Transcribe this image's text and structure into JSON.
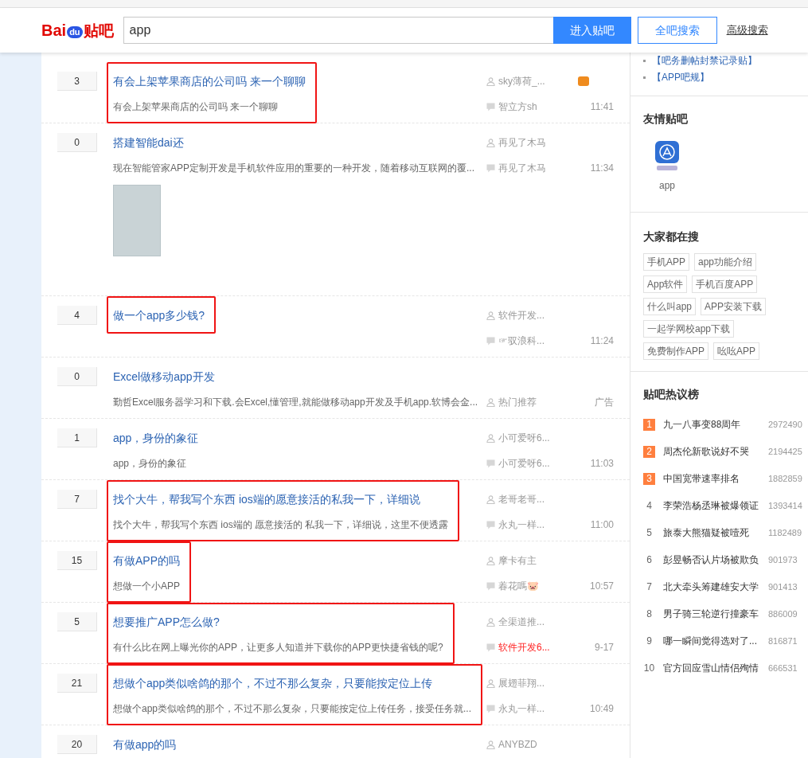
{
  "header": {
    "logo": {
      "text_a": "Bai",
      "text_b": "du",
      "text_c": "贴吧"
    },
    "search": {
      "value": "app"
    },
    "buttons": [
      {
        "label": "进入贴吧",
        "kind": "primary"
      },
      {
        "label": "全吧搜索",
        "kind": "outline"
      }
    ],
    "advanced_link": "高级搜索"
  },
  "threads": [
    {
      "kind": "thread",
      "replies": "3",
      "title": "有会上架苹果商店的公司吗 来一个聊聊",
      "abstract": "有会上架苹果商店的公司吗 来一个聊聊",
      "author": "sky薄荷_...",
      "author_badge": true,
      "replier": "智立方sh",
      "replier_vip": false,
      "time": "11:41",
      "highlighted": true
    },
    {
      "kind": "thread",
      "replies": "0",
      "title": "搭建智能dai还",
      "abstract": "现在智能管家APP定制开发是手机软件应用的重要的一种开发，随着移动互联网的覆...",
      "image": true,
      "author": "再见了木马",
      "replier": "再见了木马",
      "replier_vip": false,
      "time": "11:34",
      "highlighted": false
    },
    {
      "kind": "thread",
      "replies": "4",
      "title": "做一个app多少钱?",
      "author": "软件开发...",
      "replier": "☞驭浪科...",
      "replier_vip": false,
      "time": "11:24",
      "highlighted": true
    },
    {
      "kind": "ad",
      "replies": "0",
      "title": "Excel做移动app开发",
      "abstract": "勤哲Excel服务器学习和下载.会Excel,懂管理,就能做移动app开发及手机app.软博会金...",
      "author": "热门推荐",
      "time": "广告",
      "highlighted": false
    },
    {
      "kind": "thread",
      "replies": "1",
      "title": "app，身份的象征",
      "abstract": "app，身份的象征",
      "author": "小可爱呀6...",
      "replier": "小可爱呀6...",
      "replier_vip": false,
      "time": "11:03",
      "highlighted": false
    },
    {
      "kind": "thread",
      "replies": "7",
      "title": "找个大牛，帮我写个东西 ios端的愿意接活的私我一下，详细说",
      "abstract": "找个大牛，帮我写个东西 ios端的 愿意接活的 私我一下，详细说，这里不便透露",
      "author": "老哥老哥...",
      "replier": "永丸一样...",
      "replier_vip": false,
      "time": "11:00",
      "highlighted": true
    },
    {
      "kind": "thread",
      "replies": "15",
      "title": "有做APP的吗",
      "abstract": "想做一个小APP",
      "author": "摩卡有主",
      "replier": "萶花嗎🐷",
      "replier_vip": false,
      "time": "10:57",
      "highlighted": true
    },
    {
      "kind": "thread",
      "replies": "5",
      "title": "想要推广APP怎么做?",
      "abstract": "有什么比在网上曝光你的APP，让更多人知道并下载你的APP更快捷省钱的呢?",
      "author": "全渠道推...",
      "replier": "软件开发6...",
      "replier_vip": true,
      "time": "9-17",
      "highlighted": true
    },
    {
      "kind": "thread",
      "replies": "21",
      "title": "想做个app类似啥鸽的那个，不过不那么复杂，只要能按定位上传",
      "abstract": "想做个app类似啥鸽的那个，不过不那么复杂，只要能按定位上传任务，接受任务就...",
      "author": "展翅菲翔...",
      "replier": "永丸一样...",
      "replier_vip": false,
      "time": "10:49",
      "highlighted": true
    },
    {
      "kind": "thread",
      "replies": "20",
      "title": "有做app的吗",
      "author": "ANYBZD",
      "highlighted": false
    }
  ],
  "sidebar": {
    "links": [
      "【吧务删帖封禁记录贴】",
      "【APP吧规】"
    ],
    "friend_bars": {
      "title": "友情贴吧",
      "items": [
        {
          "name": "app"
        }
      ]
    },
    "searches": {
      "title": "大家都在搜",
      "tags": [
        "手机APP",
        "app功能介绍",
        "App软件",
        "手机百度APP",
        "什么叫app",
        "APP安装下载",
        "一起学网校app下载",
        "免费制作APP",
        "吆吆APP"
      ]
    },
    "hot": {
      "title": "贴吧热议榜",
      "items": [
        {
          "rank": "1",
          "title": "九一八事变88周年",
          "count": "2972490",
          "top": true
        },
        {
          "rank": "2",
          "title": "周杰伦新歌说好不哭",
          "count": "2194425",
          "top": true
        },
        {
          "rank": "3",
          "title": "中国宽带速率排名",
          "count": "1882859",
          "top": true
        },
        {
          "rank": "4",
          "title": "李荣浩杨丞琳被爆领证",
          "count": "1393414",
          "top": false
        },
        {
          "rank": "5",
          "title": "旅泰大熊猫疑被噎死",
          "count": "1182489",
          "top": false
        },
        {
          "rank": "6",
          "title": "彭昱畅否认片场被欺负",
          "count": "901973",
          "top": false
        },
        {
          "rank": "7",
          "title": "北大牵头筹建雄安大学",
          "count": "901413",
          "top": false
        },
        {
          "rank": "8",
          "title": "男子骑三轮逆行撞豪车",
          "count": "886009",
          "top": false
        },
        {
          "rank": "9",
          "title": "哪一瞬间觉得选对了...",
          "count": "816871",
          "top": false
        },
        {
          "rank": "10",
          "title": "官方回应雪山情侣殉情",
          "count": "666531",
          "top": false
        }
      ]
    }
  }
}
